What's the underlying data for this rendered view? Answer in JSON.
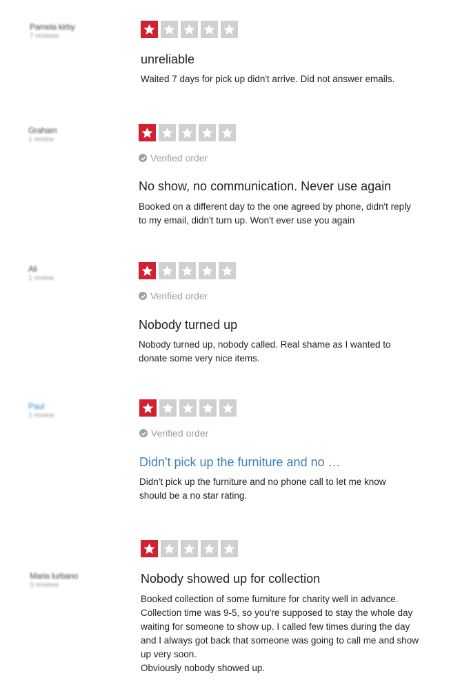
{
  "colors": {
    "star_filled": "#d1202f",
    "star_empty": "#d0d0d0",
    "link": "#3d7eb8"
  },
  "reviews": [
    {
      "author": "Pamela kirby",
      "review_count": "7 reviews",
      "rating": 1,
      "verified": "",
      "title": "unreliable",
      "body": "Waited 7 days for pick up didn't arrive. Did not answer emails."
    },
    {
      "author": "Graham",
      "review_count": "1 review",
      "rating": 1,
      "verified": "Verified order",
      "title": "No show, no communication. Never use again",
      "body": "Booked on a different day to the one agreed by phone, didn't reply\nto my email, didn't turn up. Won't ever use you again"
    },
    {
      "author": "Ali",
      "review_count": "1 review",
      "rating": 1,
      "verified": "Verified order",
      "title": "Nobody turned up",
      "body": "Nobody turned up, nobody called. Real shame as I wanted to\ndonate some very nice items."
    },
    {
      "author": "Paul",
      "review_count": "1 review",
      "rating": 1,
      "verified": "Verified order",
      "title": "Didn't pick up the furniture and no …",
      "body": "Didn't pick up the furniture and no phone call to let me know\nshould be a no star rating."
    },
    {
      "author": "Maria Iurbano",
      "review_count": "3 reviews",
      "rating": 1,
      "verified": "",
      "title": "Nobody showed up for collection",
      "body": "Booked collection of some furniture for charity well in advance.\nCollection time was 9-5, so you're supposed to stay the whole day\nwaiting for someone to show up. I called few times during the day\nand I always got back that someone was going to call me and show\nup very soon.\nObviously nobody showed up."
    }
  ]
}
